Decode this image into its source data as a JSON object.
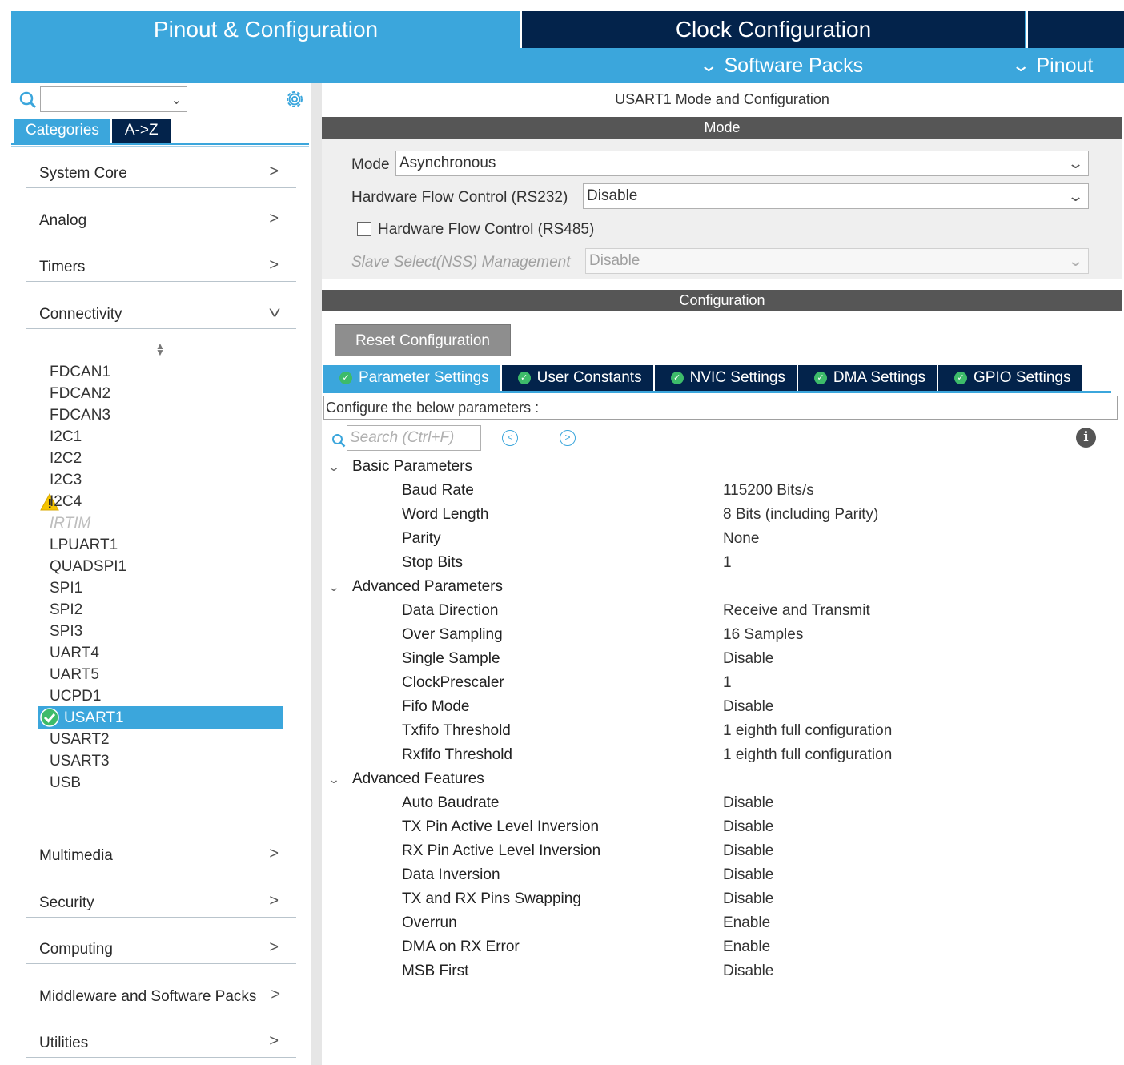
{
  "top_tabs": {
    "pinout_config": "Pinout & Configuration",
    "clock_config": "Clock Configuration",
    "software_packs": "Software Packs",
    "pinout": "Pinout"
  },
  "left_panel": {
    "search_value": "",
    "tabs": {
      "categories": "Categories",
      "a_to_z": "A->Z"
    },
    "categories": [
      "System Core",
      "Analog",
      "Timers",
      "Connectivity",
      "Multimedia",
      "Security",
      "Computing",
      "Middleware and Software Packs",
      "Utilities"
    ],
    "connectivity_items": [
      "FDCAN1",
      "FDCAN2",
      "FDCAN3",
      "I2C1",
      "I2C2",
      "I2C3",
      "I2C4",
      "IRTIM",
      "LPUART1",
      "QUADSPI1",
      "SPI1",
      "SPI2",
      "SPI3",
      "UART4",
      "UART5",
      "UCPD1",
      "USART1",
      "USART2",
      "USART3",
      "USB"
    ],
    "selected_item": "USART1",
    "warning_item": "I2C4",
    "disabled_item": "IRTIM"
  },
  "right_panel": {
    "title": "USART1 Mode and Configuration",
    "mode_header": "Mode",
    "mode": {
      "mode_label": "Mode",
      "mode_value": "Asynchronous",
      "hw_flow_rs232_label": "Hardware Flow Control (RS232)",
      "hw_flow_rs232_value": "Disable",
      "hw_flow_rs485_label": "Hardware Flow Control (RS485)",
      "hw_flow_rs485_checked": false,
      "slave_select_label": "Slave Select(NSS) Management",
      "slave_select_value": "Disable"
    },
    "config_header": "Configuration",
    "reset_button": "Reset Configuration",
    "config_tabs": [
      "Parameter Settings",
      "User Constants",
      "NVIC Settings",
      "DMA Settings",
      "GPIO Settings"
    ],
    "active_config_tab": "Parameter Settings",
    "configure_text": "Configure the below parameters :",
    "search_placeholder": "Search (Ctrl+F)",
    "groups": [
      {
        "name": "Basic Parameters",
        "params": [
          [
            "Baud Rate",
            "115200 Bits/s"
          ],
          [
            "Word Length",
            "8 Bits (including Parity)"
          ],
          [
            "Parity",
            "None"
          ],
          [
            "Stop Bits",
            "1"
          ]
        ]
      },
      {
        "name": "Advanced Parameters",
        "params": [
          [
            "Data Direction",
            "Receive and Transmit"
          ],
          [
            "Over Sampling",
            "16 Samples"
          ],
          [
            "Single Sample",
            "Disable"
          ],
          [
            "ClockPrescaler",
            "1"
          ],
          [
            "Fifo Mode",
            "Disable"
          ],
          [
            "Txfifo Threshold",
            "1 eighth full configuration"
          ],
          [
            "Rxfifo Threshold",
            "1 eighth full configuration"
          ]
        ]
      },
      {
        "name": "Advanced Features",
        "params": [
          [
            "Auto Baudrate",
            "Disable"
          ],
          [
            "TX Pin Active Level Inversion",
            "Disable"
          ],
          [
            "RX Pin Active Level Inversion",
            "Disable"
          ],
          [
            "Data Inversion",
            "Disable"
          ],
          [
            "TX and RX Pins Swapping",
            "Disable"
          ],
          [
            "Overrun",
            "Enable"
          ],
          [
            "DMA on RX Error",
            "Enable"
          ],
          [
            "MSB First",
            "Disable"
          ]
        ]
      }
    ]
  },
  "colors": {
    "accent_blue": "#3ba6dc",
    "dark_navy": "#03234b",
    "header_gray": "#565656",
    "ok_green": "#3dbb6a",
    "warning_yellow": "#f5c400"
  }
}
